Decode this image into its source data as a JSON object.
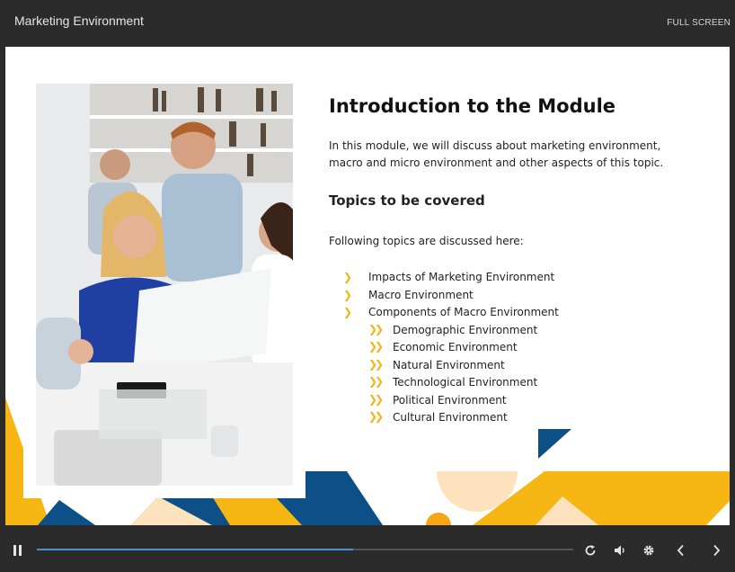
{
  "window": {
    "title": "Marketing Environment",
    "fullscreen_label": "FULL SCREEN"
  },
  "slide": {
    "heading": "Introduction to the Module",
    "intro": "In this module, we will discuss about marketing environment, macro and micro environment and other aspects of this topic.",
    "subheading": "Topics to be covered",
    "lead": "Following topics are discussed here:",
    "topics": [
      {
        "label": "Impacts of Marketing Environment",
        "level": 1
      },
      {
        "label": "Macro Environment",
        "level": 1
      },
      {
        "label": "Components of Macro Environment",
        "level": 1
      },
      {
        "label": "Demographic Environment",
        "level": 2
      },
      {
        "label": "Economic Environment",
        "level": 2
      },
      {
        "label": "Natural Environment",
        "level": 2
      },
      {
        "label": "Technological Environment",
        "level": 2
      },
      {
        "label": "Political Environment",
        "level": 2
      },
      {
        "label": "Cultural Environment",
        "level": 2
      }
    ],
    "photo_icon": "office-team-photo"
  },
  "player": {
    "progress": 0.59,
    "icons": [
      "pause-icon",
      "replay-icon",
      "volume-icon",
      "settings-icon",
      "previous-icon",
      "next-icon"
    ]
  },
  "colors": {
    "accent_yellow": "#f6b714",
    "navy": "#0d4f87",
    "peach": "#fde3bd",
    "progress_blue": "#4a90d9",
    "chrome": "#2b2b2b"
  }
}
